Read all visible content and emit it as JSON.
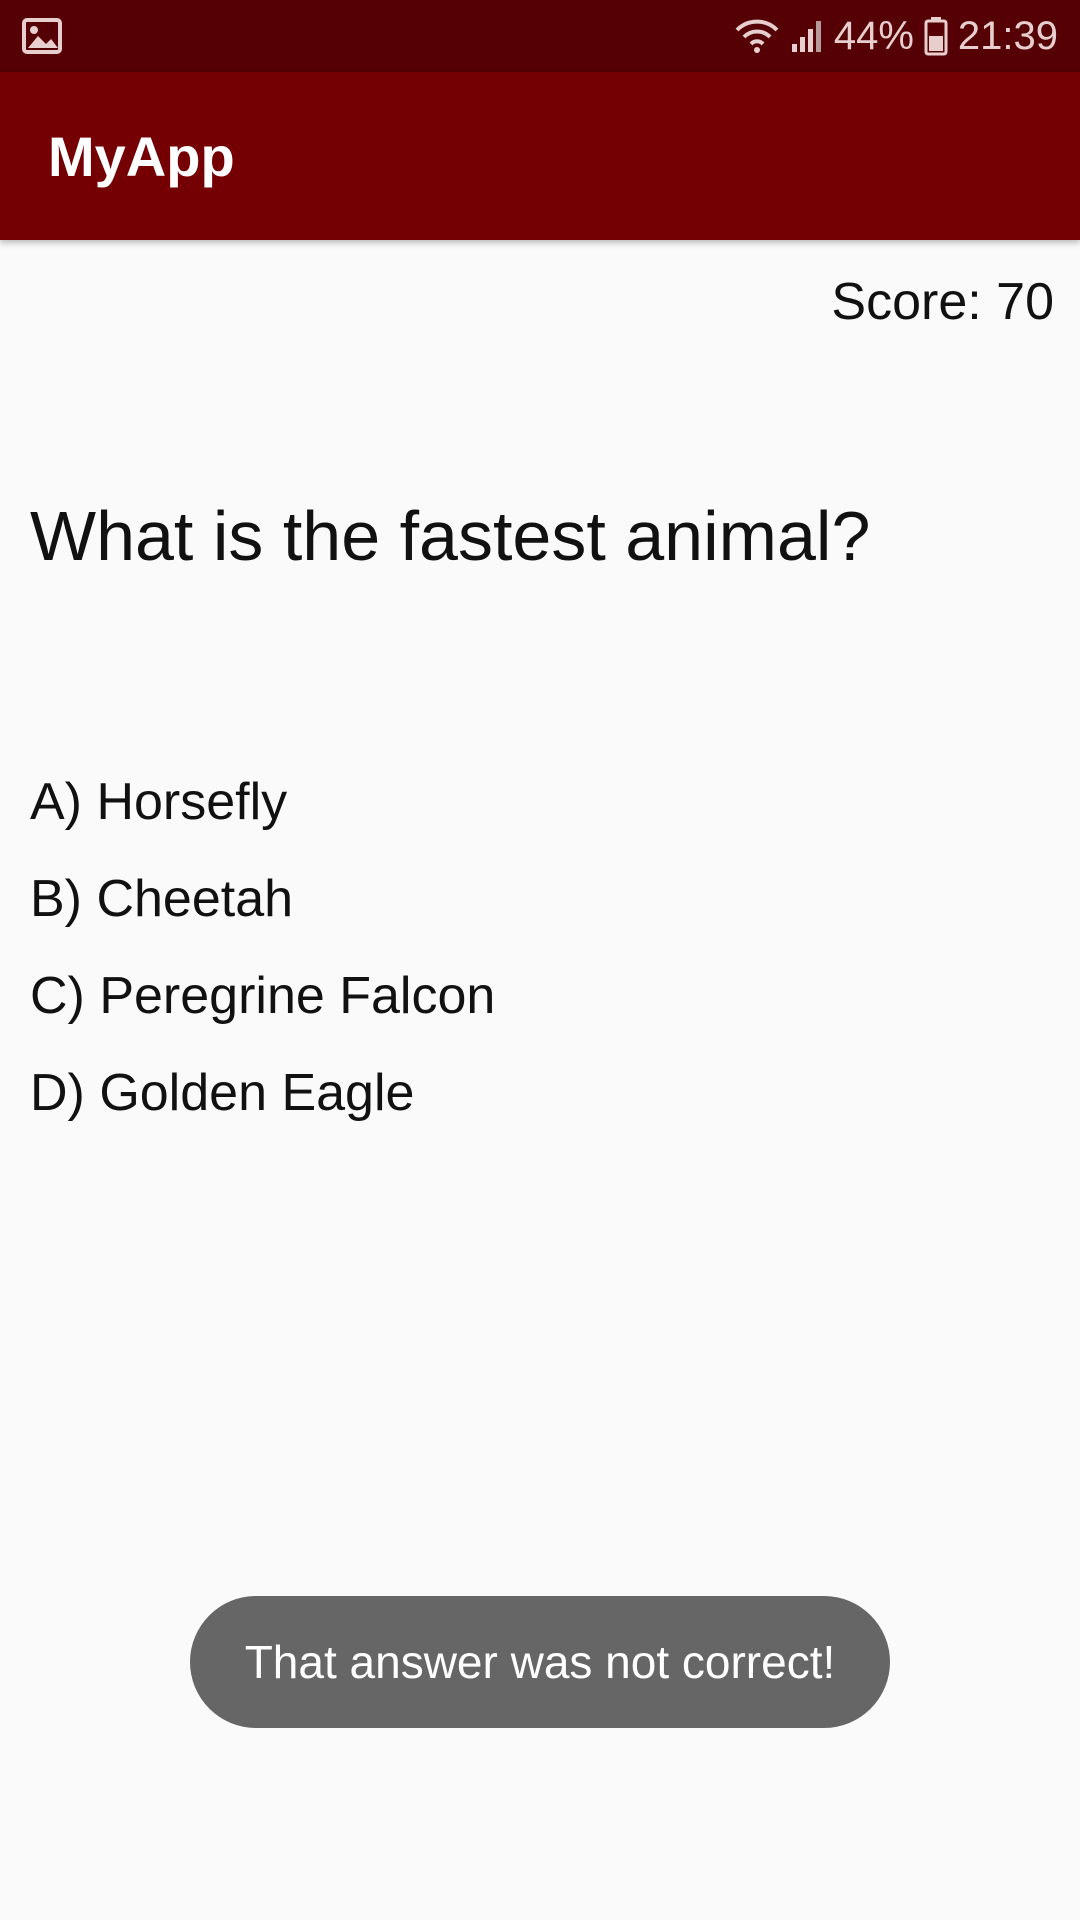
{
  "status_bar": {
    "left_icon": "image-icon",
    "icons": [
      "wifi-icon",
      "signal-icon",
      "battery-icon"
    ],
    "battery": "44%",
    "time": "21:39"
  },
  "app_bar": {
    "title": "MyApp"
  },
  "quiz": {
    "score": "Score: 70",
    "question": "What is the fastest animal?",
    "answers": [
      {
        "label": "A) Horsefly"
      },
      {
        "label": "B) Cheetah"
      },
      {
        "label": "C) Peregrine Falcon"
      },
      {
        "label": "D) Golden Eagle"
      }
    ]
  },
  "toast": {
    "message": "That answer was not correct!"
  },
  "colors": {
    "status_bar": "#540004",
    "app_bar": "#740003",
    "background": "#fafafa",
    "toast": "#666666"
  }
}
